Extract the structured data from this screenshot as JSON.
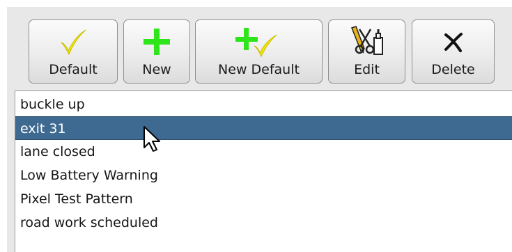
{
  "toolbar": {
    "buttons": [
      {
        "label": "Default",
        "icon": "checkmark-icon"
      },
      {
        "label": "New",
        "icon": "plus-icon"
      },
      {
        "label": "New Default",
        "icon": "plus-checkmark-icon"
      },
      {
        "label": "Edit",
        "icon": "edit-tools-icon"
      },
      {
        "label": "Delete",
        "icon": "delete-x-icon"
      }
    ]
  },
  "list": {
    "items": [
      "buckle up",
      "exit 31",
      "lane closed",
      "Low Battery Warning",
      "Pixel Test Pattern",
      "road work scheduled"
    ],
    "selected": "exit 31"
  },
  "colors": {
    "selection": "#3e6a91",
    "check_yellow": "#f2e600",
    "plus_green": "#2ee51a",
    "window_bg": "#e8e8e8"
  }
}
